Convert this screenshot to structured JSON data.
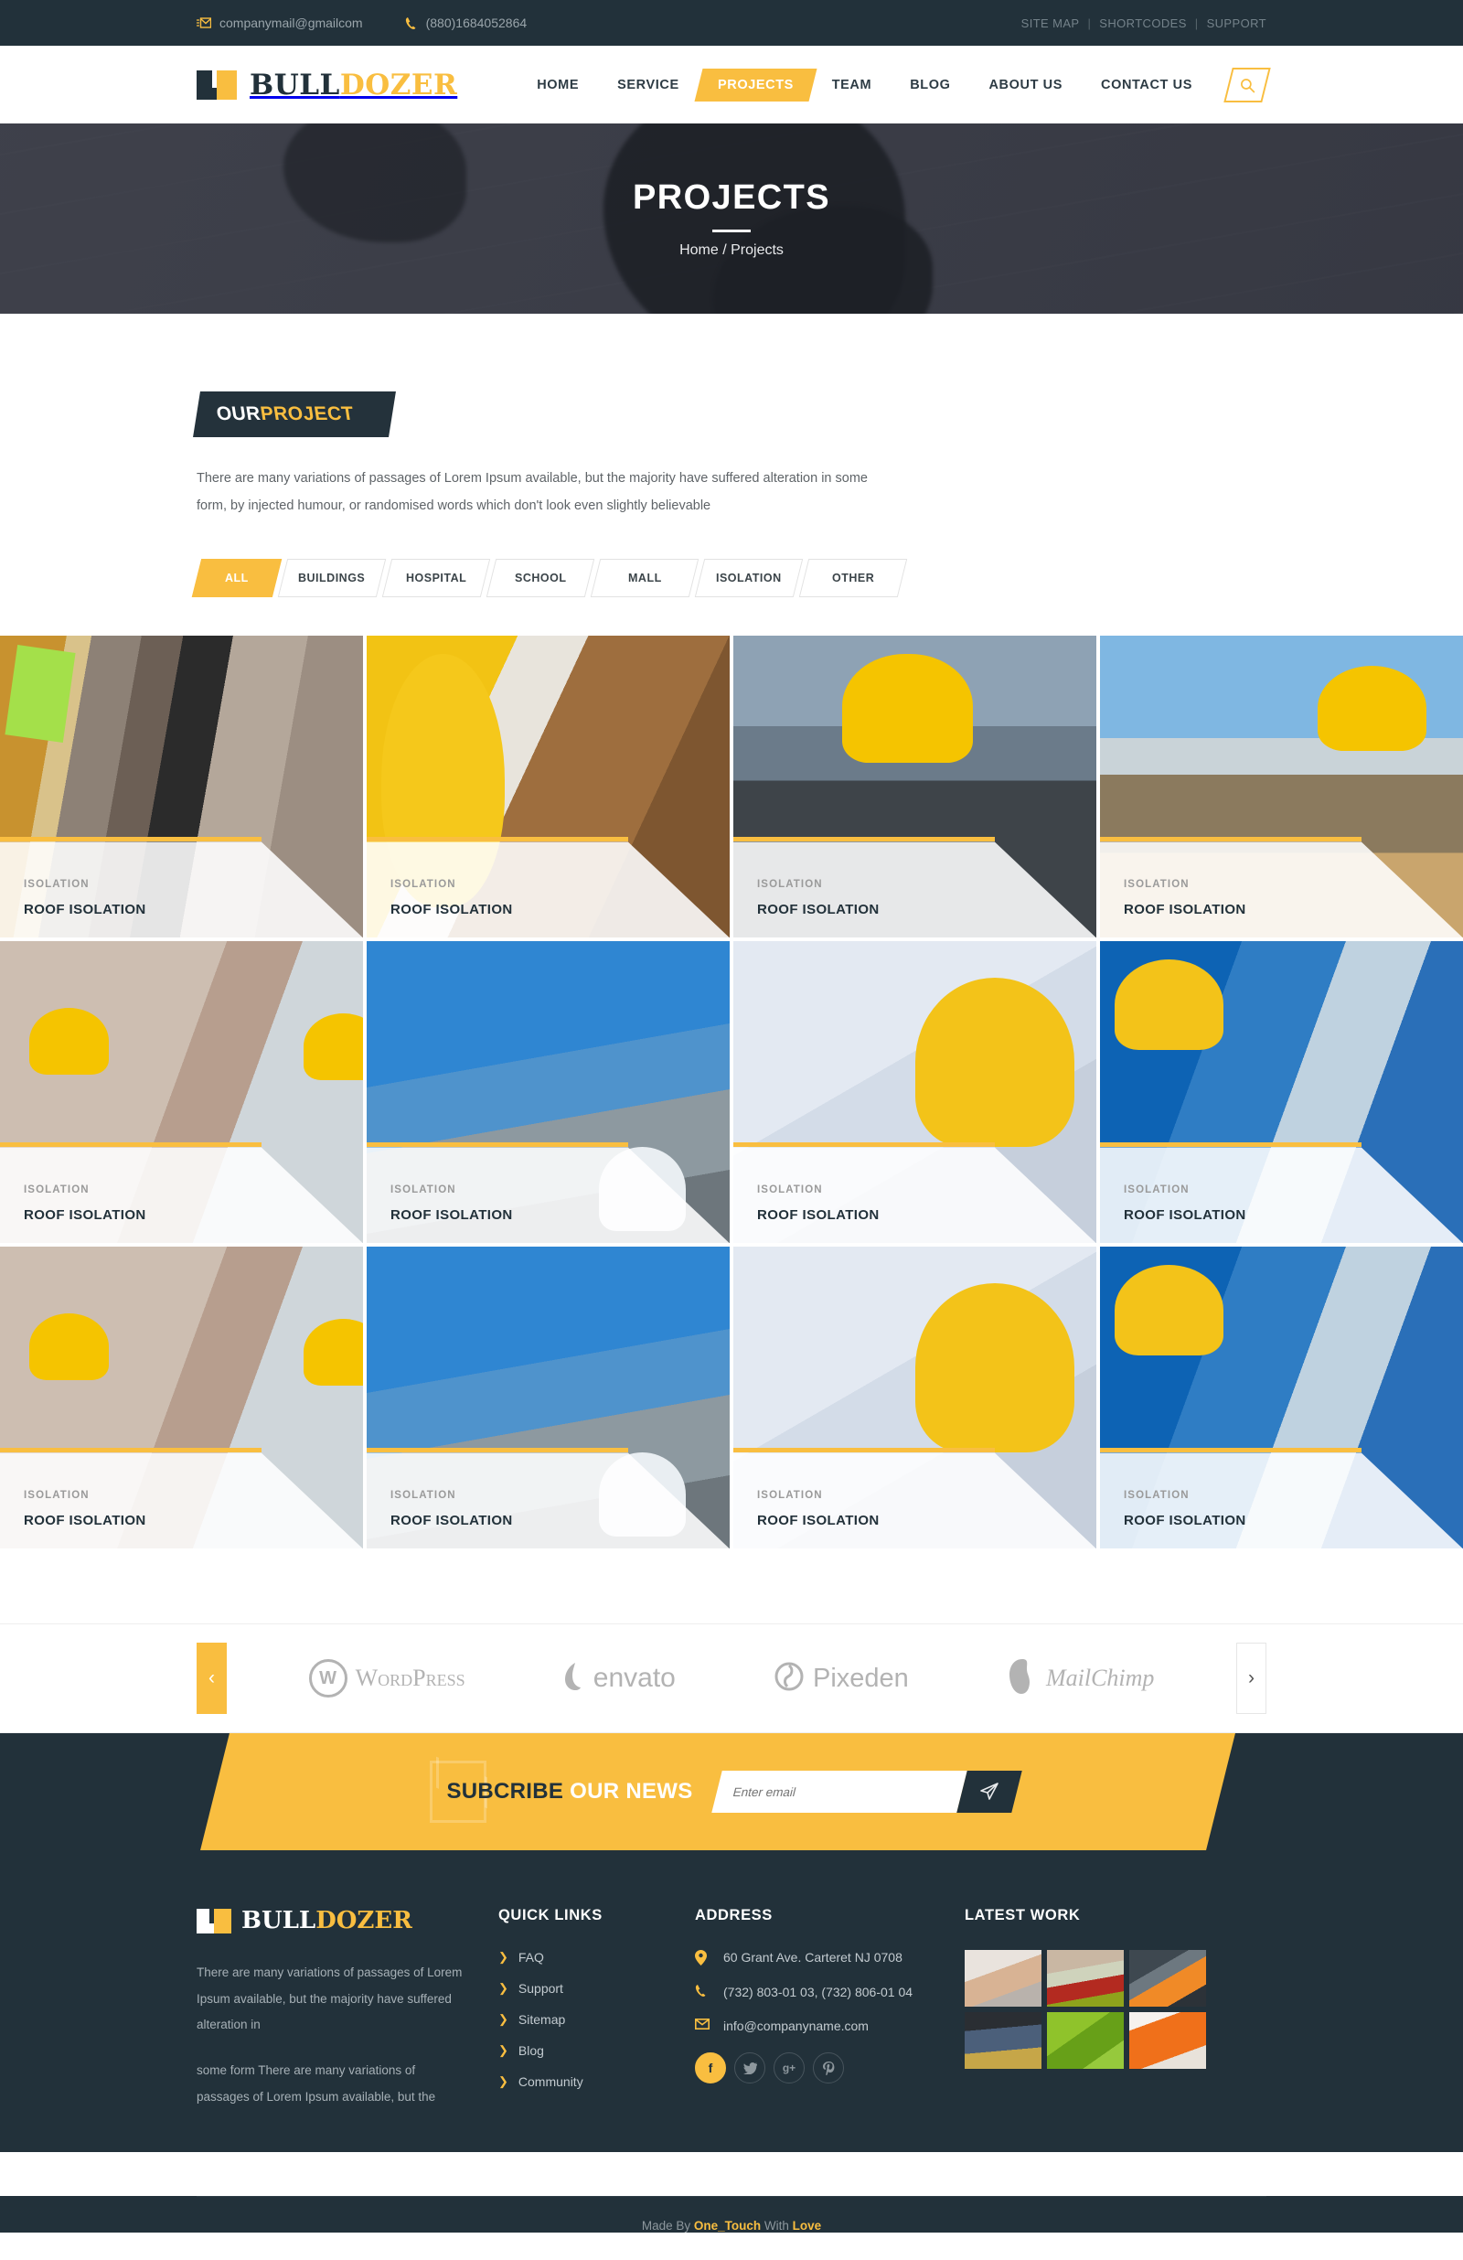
{
  "topbar": {
    "email": "companymail@gmailcom",
    "phone": "(880)1684052864",
    "email_icon": "envelope-icon",
    "phone_icon": "phone-icon",
    "links": [
      "SITE MAP",
      "SHORTCODES",
      "SUPPORT"
    ],
    "separator": "|"
  },
  "header": {
    "logo": {
      "primary": "BULL",
      "secondary": "DOZER"
    },
    "nav": [
      {
        "label": "HOME",
        "active": false
      },
      {
        "label": "SERVICE",
        "active": false
      },
      {
        "label": "PROJECTS",
        "active": true
      },
      {
        "label": "TEAM",
        "active": false
      },
      {
        "label": "BLOG",
        "active": false
      },
      {
        "label": "ABOUT US",
        "active": false
      },
      {
        "label": "CONTACT US",
        "active": false
      }
    ],
    "search_icon": "search-icon"
  },
  "hero": {
    "title": "PROJECTS",
    "crumb_home": "Home",
    "crumb_sep": "/",
    "crumb_current": "Projects"
  },
  "section": {
    "tag_first": "OUR ",
    "tag_second": "PROJECT",
    "lead": "There are many variations of passages of Lorem Ipsum available, but the majority have suffered alteration in some form, by injected humour, or randomised words which don't look even slightly believable"
  },
  "filters": [
    {
      "label": "ALL",
      "active": true
    },
    {
      "label": "BUILDINGS",
      "active": false
    },
    {
      "label": "HOSPITAL",
      "active": false
    },
    {
      "label": "SCHOOL",
      "active": false
    },
    {
      "label": "MALL",
      "active": false
    },
    {
      "label": "ISOLATION",
      "active": false
    },
    {
      "label": "OTHER",
      "active": false
    }
  ],
  "projects": [
    {
      "category": "ISOLATION",
      "title": "ROOF ISOLATION"
    },
    {
      "category": "ISOLATION",
      "title": "ROOF ISOLATION"
    },
    {
      "category": "ISOLATION",
      "title": "ROOF ISOLATION"
    },
    {
      "category": "ISOLATION",
      "title": "ROOF ISOLATION"
    },
    {
      "category": "ISOLATION",
      "title": "ROOF ISOLATION"
    },
    {
      "category": "ISOLATION",
      "title": "ROOF ISOLATION"
    },
    {
      "category": "ISOLATION",
      "title": "ROOF ISOLATION"
    },
    {
      "category": "ISOLATION",
      "title": "ROOF ISOLATION"
    },
    {
      "category": "ISOLATION",
      "title": "ROOF ISOLATION"
    },
    {
      "category": "ISOLATION",
      "title": "ROOF ISOLATION"
    },
    {
      "category": "ISOLATION",
      "title": "ROOF ISOLATION"
    },
    {
      "category": "ISOLATION",
      "title": "ROOF ISOLATION"
    }
  ],
  "partners": {
    "prev_icon": "chevron-left-icon",
    "next_icon": "chevron-right-icon",
    "logos": [
      {
        "name": "WordPress",
        "icon": "wordpress-icon"
      },
      {
        "name": "envato",
        "icon": "envato-icon"
      },
      {
        "name": "Pixeden",
        "icon": "pixeden-icon"
      },
      {
        "name": "MailChimp",
        "icon": "mailchimp-icon"
      }
    ]
  },
  "subscribe": {
    "title_dark": "SUBCRIBE",
    "title_light": " OUR NEWS",
    "placeholder": "Enter email",
    "value": "",
    "send_icon": "paper-plane-icon",
    "envelope_icon": "envelope-outline-icon"
  },
  "footer": {
    "logo": {
      "primary": "BULL",
      "secondary": "DOZER"
    },
    "about_p1": "There are many variations of passages of Lorem Ipsum available, but the majority have suffered alteration in",
    "about_p2": "some form There are many variations of passages of Lorem Ipsum available, but the",
    "quick_links_head": "QUICK LINKS",
    "quick_links": [
      "FAQ",
      "Support",
      "Sitemap",
      "Blog",
      "Community"
    ],
    "address_head": "ADDRESS",
    "address_line": "60 Grant Ave. Carteret NJ 0708",
    "phone_line": "(732) 803-01 03, (732) 806-01 04",
    "email_line": "info@companyname.com",
    "socials": [
      {
        "name": "facebook",
        "glyph": "f"
      },
      {
        "name": "twitter",
        "glyph": "t"
      },
      {
        "name": "google-plus",
        "glyph": "g+"
      },
      {
        "name": "pinterest",
        "glyph": "p"
      }
    ],
    "work_head": "LATEST WORK",
    "bottom_prefix": "Made By ",
    "bottom_brand": "One_Touch",
    "bottom_mid": " With ",
    "bottom_love": "Love"
  },
  "colors": {
    "accent": "#f9be40",
    "dark": "#22313a",
    "muted": "#9aa5ab"
  }
}
